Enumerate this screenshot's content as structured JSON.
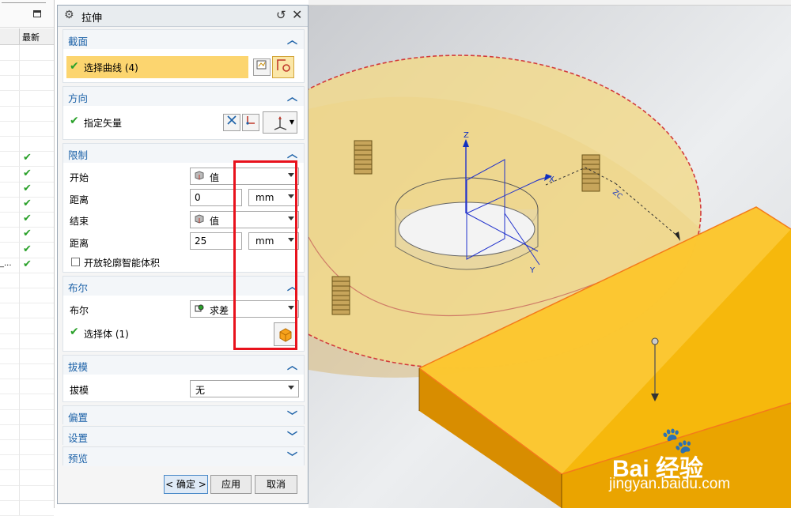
{
  "nav": {
    "col_header": "最新",
    "truncated_item": "_...",
    "check_glyph": "✔"
  },
  "dialog": {
    "title": "拉伸",
    "sections": {
      "section": {
        "title": "截面",
        "select_curve": "选择曲线 (4)"
      },
      "direction": {
        "title": "方向",
        "specify_vector": "指定矢量"
      },
      "limits": {
        "title": "限制",
        "start_label": "开始",
        "start_value": "值",
        "distance1_label": "距离",
        "distance1_value": "0",
        "distance1_unit": "mm",
        "end_label": "结束",
        "end_value": "值",
        "distance2_label": "距离",
        "distance2_value": "25",
        "distance2_unit": "mm",
        "open_profile": "开放轮廓智能体积"
      },
      "boolean": {
        "title": "布尔",
        "boolean_label": "布尔",
        "boolean_value": "求差",
        "select_body": "选择体 (1)"
      },
      "draft": {
        "title": "拔模",
        "draft_label": "拔模",
        "draft_value": "无"
      },
      "offset": {
        "title": "偏置"
      },
      "settings": {
        "title": "设置"
      },
      "preview": {
        "title": "预览"
      }
    },
    "buttons": {
      "ok": "< 确定 >",
      "apply": "应用",
      "cancel": "取消"
    }
  },
  "viewport": {
    "axis_labels": {
      "z": "Z",
      "x": "X",
      "y": "Y",
      "zc": "ZC",
      "yc": "YC"
    },
    "watermark": {
      "brand": "Bai  经验",
      "url": "jingyan.baidu.com"
    }
  },
  "colors": {
    "accent": "#1d62a8",
    "selection_highlight": "#fcd56f",
    "check": "#2aa12a",
    "annotation_red": "#e8121c",
    "disc_fill": "#f1d98a",
    "box_fill": "#f7b500"
  }
}
